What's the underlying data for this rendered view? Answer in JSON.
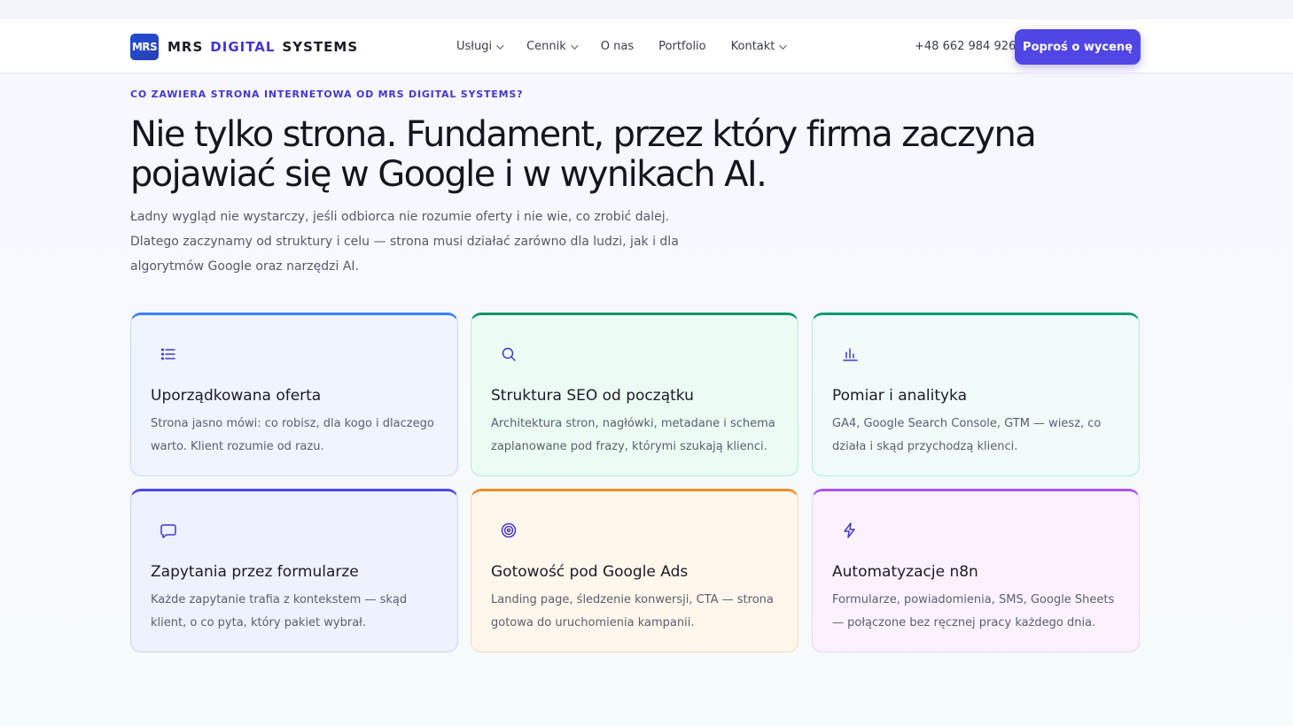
{
  "nav": {
    "logo_badge": "MRS",
    "logo_word1": "MRS",
    "logo_word2": "DIGITAL",
    "logo_word3": "SYSTEMS",
    "items": [
      {
        "label": "Usługi",
        "dropdown": true
      },
      {
        "label": "Cennik",
        "dropdown": true
      },
      {
        "label": "O nas",
        "dropdown": false
      },
      {
        "label": "Portfolio",
        "dropdown": false
      },
      {
        "label": "Kontakt",
        "dropdown": true
      }
    ],
    "phone": "+48 662 984 926",
    "cta_label": "Poproś o wycenę"
  },
  "hero": {
    "eyebrow": "CO ZAWIERA STRONA INTERNETOWA OD MRS DIGITAL SYSTEMS?",
    "title": "Nie tylko strona. Fundament, przez który firma zaczyna pojawiać się w Google i w wynikach AI.",
    "lead": "Ładny wygląd nie wystarczy, jeśli odbiorca nie rozumie oferty i nie wie, co zrobić dalej. Dlatego zaczynamy od struktury i celu — strona musi działać zarówno dla ludzi, jak i dla algorytmów Google oraz narzędzi AI."
  },
  "features": [
    {
      "icon": "list-icon",
      "title": "Uporządkowana oferta",
      "desc": "Strona jasno mówi: co robisz, dla kogo i dlaczego warto. Klient rozumie od razu.",
      "accent": "#3b82f6",
      "bg": "#eff4ff",
      "border": "#c7d8fb"
    },
    {
      "icon": "search-icon",
      "title": "Struktura SEO od początku",
      "desc": "Architektura stron, nagłówki, metadane i schema zaplanowane pod frazy, którymi szukają klienci.",
      "accent": "#10936b",
      "bg": "#ecfcf3",
      "border": "#b7ecd4"
    },
    {
      "icon": "bar-chart-icon",
      "title": "Pomiar i analityka",
      "desc": "GA4, Google Search Console, GTM — wiesz, co działa i skąd przychodzą klienci.",
      "accent": "#0f9a78",
      "bg": "#effcf9",
      "border": "#b5ecdf"
    },
    {
      "icon": "message-icon",
      "title": "Zapytania przez formularze",
      "desc": "Każde zapytanie trafia z kontekstem — skąd klient, o co pyta, który pakiet wybrał.",
      "accent": "#4f46e5",
      "bg": "#eef1fe",
      "border": "#cdd1f8"
    },
    {
      "icon": "target-icon",
      "title": "Gotowość pod Google Ads",
      "desc": "Landing page, śledzenie konwersji, CTA — strona gotowa do uruchomienia kampanii.",
      "accent": "#f08c2a",
      "bg": "#fff6ec",
      "border": "#f9d9b5"
    },
    {
      "icon": "bolt-icon",
      "title": "Automatyzacje n8n",
      "desc": "Formularze, powiadomienia, SMS, Google Sheets — połączone bez ręcznej pracy każdego dnia.",
      "accent": "#a855f7",
      "bg": "#fcf2ff",
      "border": "#ecd2f7"
    }
  ]
}
